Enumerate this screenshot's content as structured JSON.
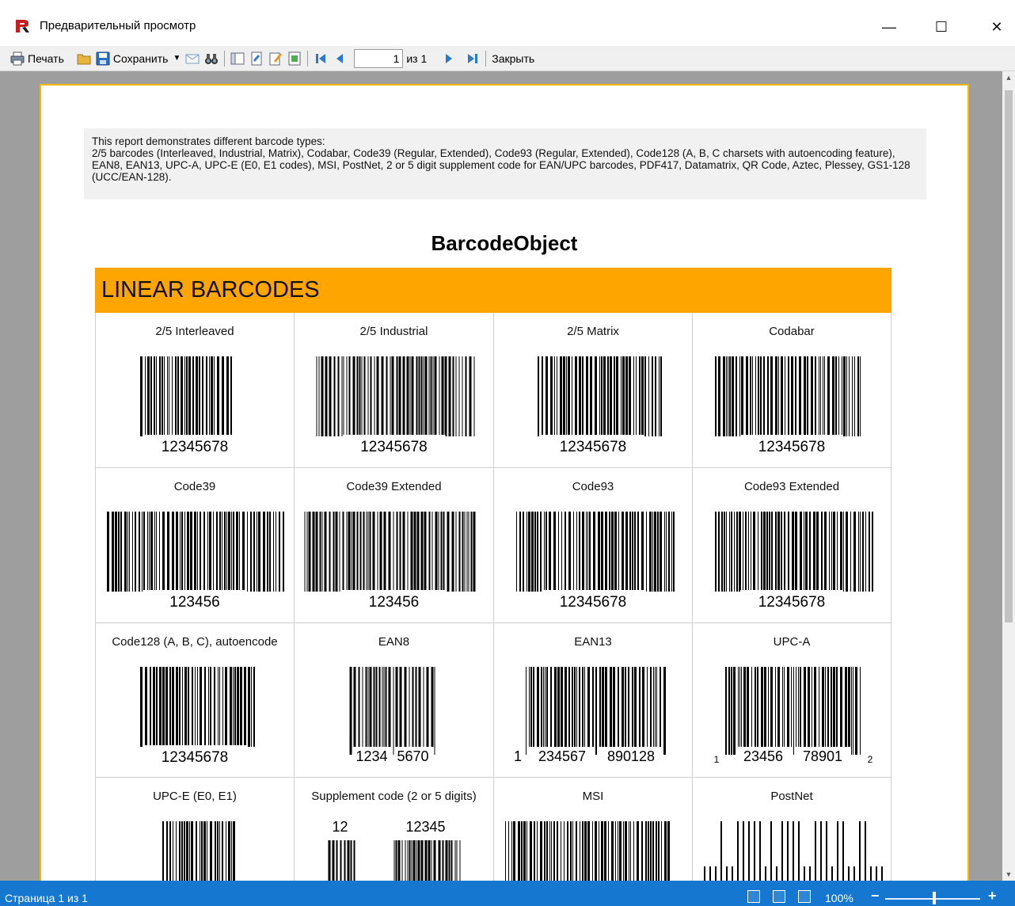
{
  "window": {
    "title": "Предварительный просмотр",
    "controls": {
      "minimize": "—",
      "maximize": "☐",
      "close": "✕"
    }
  },
  "toolbar": {
    "print_label": "Печать",
    "save_label": "Сохранить",
    "page_value": "1",
    "page_of": "из 1",
    "close_label": "Закрыть"
  },
  "report": {
    "info": "This report demonstrates different barcode types:\n2/5 barcodes (Interleaved, Industrial, Matrix), Codabar, Code39 (Regular, Extended), Code93 (Regular, Extended), Code128 (A, B, C charsets with autoencoding feature), EAN8, EAN13, UPC-A, UPC-E (E0, E1 codes), MSI, PostNet, 2 or 5 digit supplement code for EAN/UPC barcodes, PDF417, Datamatrix, QR Code, Aztec, Plessey, GS1-128 (UCC/EAN-128).",
    "title": "BarcodeObject",
    "section": "LINEAR BARCODES",
    "cells": [
      {
        "label": "2/5 Interleaved",
        "code": "12345678",
        "kind": "plain"
      },
      {
        "label": "2/5 Industrial",
        "code": "12345678",
        "kind": "plain"
      },
      {
        "label": "2/5 Matrix",
        "code": "12345678",
        "kind": "plain"
      },
      {
        "label": "Codabar",
        "code": "12345678",
        "kind": "plain"
      },
      {
        "label": "Code39",
        "code": "123456",
        "kind": "plain"
      },
      {
        "label": "Code39 Extended",
        "code": "123456",
        "kind": "plain"
      },
      {
        "label": "Code93",
        "code": "12345678",
        "kind": "plain"
      },
      {
        "label": "Code93 Extended",
        "code": "12345678",
        "kind": "plain"
      },
      {
        "label": "Code128 (A, B, C), autoencode",
        "code": "12345678",
        "kind": "plain"
      },
      {
        "label": "EAN8",
        "kind": "ean8",
        "left": "1234",
        "right": "5670"
      },
      {
        "label": "EAN13",
        "kind": "ean13",
        "lead": "1",
        "left": "234567",
        "right": "890128"
      },
      {
        "label": "UPC-A",
        "kind": "upca",
        "lead": "1",
        "left": "23456",
        "right": "78901",
        "trail": "2"
      },
      {
        "label": "UPC-E (E0, E1)",
        "kind": "partial"
      },
      {
        "label": "Supplement code (2 or 5 digits)",
        "kind": "supplement",
        "supp2": "12",
        "supp5": "12345"
      },
      {
        "label": "MSI",
        "kind": "partial"
      },
      {
        "label": "PostNet",
        "kind": "postnet"
      }
    ]
  },
  "statusbar": {
    "page_status": "Страница 1 из 1",
    "zoom": "100%",
    "zoom_minus": "−",
    "zoom_plus": "+"
  },
  "colors": {
    "accent": "#ffa500",
    "page_border": "#f6b800",
    "status_bar": "#1577cf",
    "preview_bg": "#9e9e9e"
  }
}
